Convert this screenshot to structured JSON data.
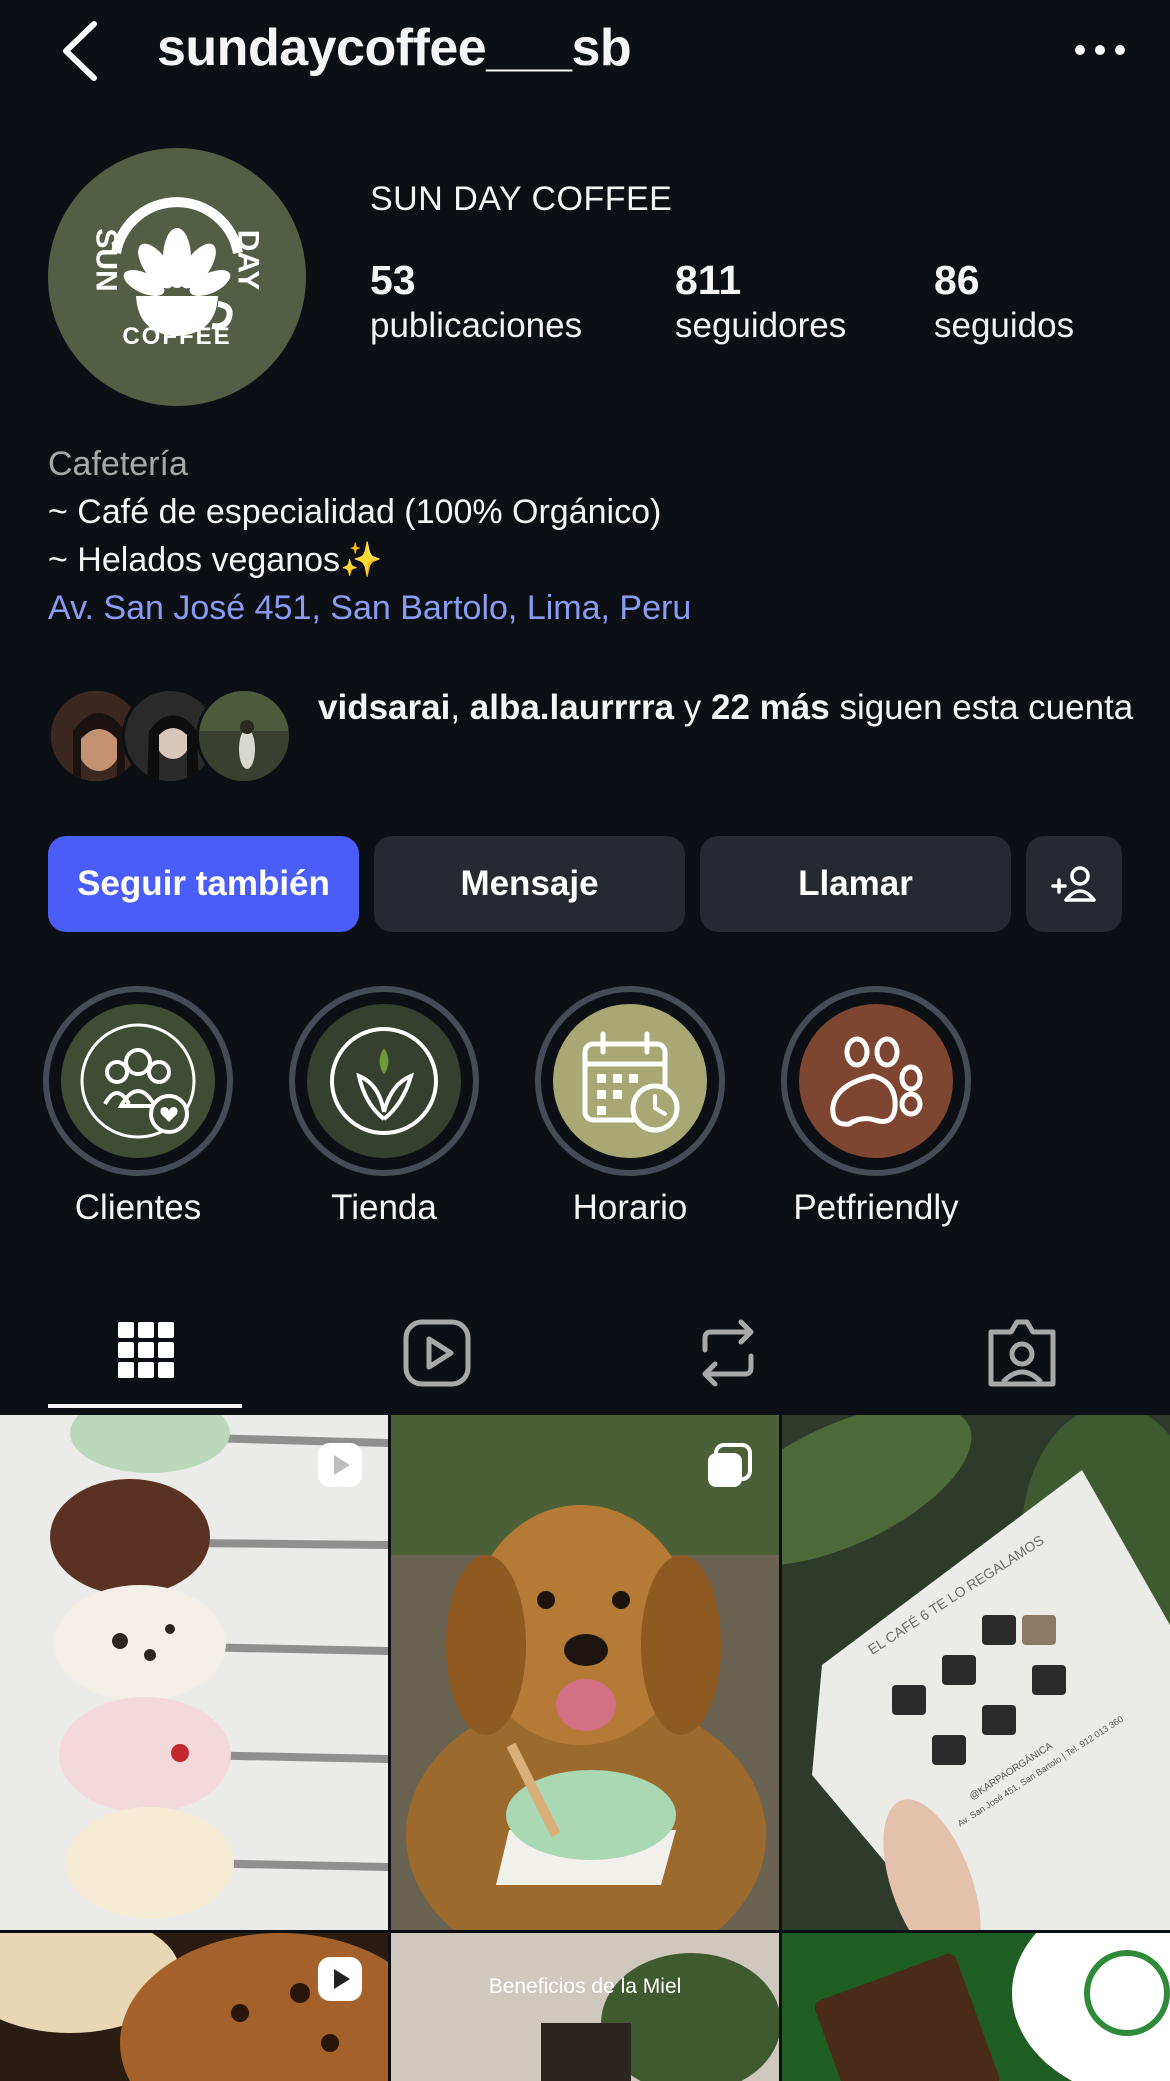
{
  "header": {
    "username": "sundaycoffee___sb",
    "back_icon": "chevron-left-icon",
    "more_icon": "more-horizontal-icon"
  },
  "profile": {
    "display_name": "SUN DAY COFFEE",
    "logo_text": {
      "left": "SUN",
      "right": "DAY",
      "bottom": "COFFEE"
    },
    "stats": [
      {
        "num": "53",
        "label": "publicaciones"
      },
      {
        "num": "811",
        "label": "seguidores"
      },
      {
        "num": "86",
        "label": "seguidos"
      }
    ]
  },
  "bio": {
    "category": "Cafetería",
    "lines": [
      "~ Café de especialidad (100% Orgánico)",
      "~ Helados veganos✨"
    ],
    "address": "Av. San José 451, San Bartolo, Lima, Peru"
  },
  "followed_by": {
    "user1": "vidsarai",
    "sep": ", ",
    "user2": "alba.laurrrra",
    "and": " y ",
    "more": "22 más",
    "suffix": " siguen esta cuenta"
  },
  "actions": {
    "follow_back": "Seguir también",
    "message": "Mensaje",
    "call": "Llamar",
    "suggest_icon": "add-person-icon"
  },
  "highlights": [
    {
      "label": "Clientes",
      "icon": "people-heart-icon",
      "color": "#3e4d34"
    },
    {
      "label": "Tienda",
      "icon": "leaf-icon",
      "color": "#35402f"
    },
    {
      "label": "Horario",
      "icon": "calendar-clock-icon",
      "color": "#a7a874"
    },
    {
      "label": "Petfriendly",
      "icon": "paw-icon",
      "color": "#7e4530"
    }
  ],
  "tabs": [
    {
      "name": "grid",
      "icon": "grid-icon",
      "active": true
    },
    {
      "name": "reels",
      "icon": "reels-icon"
    },
    {
      "name": "reposts",
      "icon": "repost-icon"
    },
    {
      "name": "tagged",
      "icon": "tagged-person-icon"
    }
  ],
  "posts": {
    "card_line1": "EL CAFÉ 6 TE LO REGALAMOS",
    "card_line2": "@KARPAORGÁNICA",
    "card_line3": "Av. San José 451, San Bartolo | Tel. 912 013 360",
    "miel_title": "Beneficios de la Miel"
  },
  "colors": {
    "background": "#0c1014",
    "accent": "#4a5df9",
    "link": "#8a9cf2",
    "button": "#262a30"
  }
}
